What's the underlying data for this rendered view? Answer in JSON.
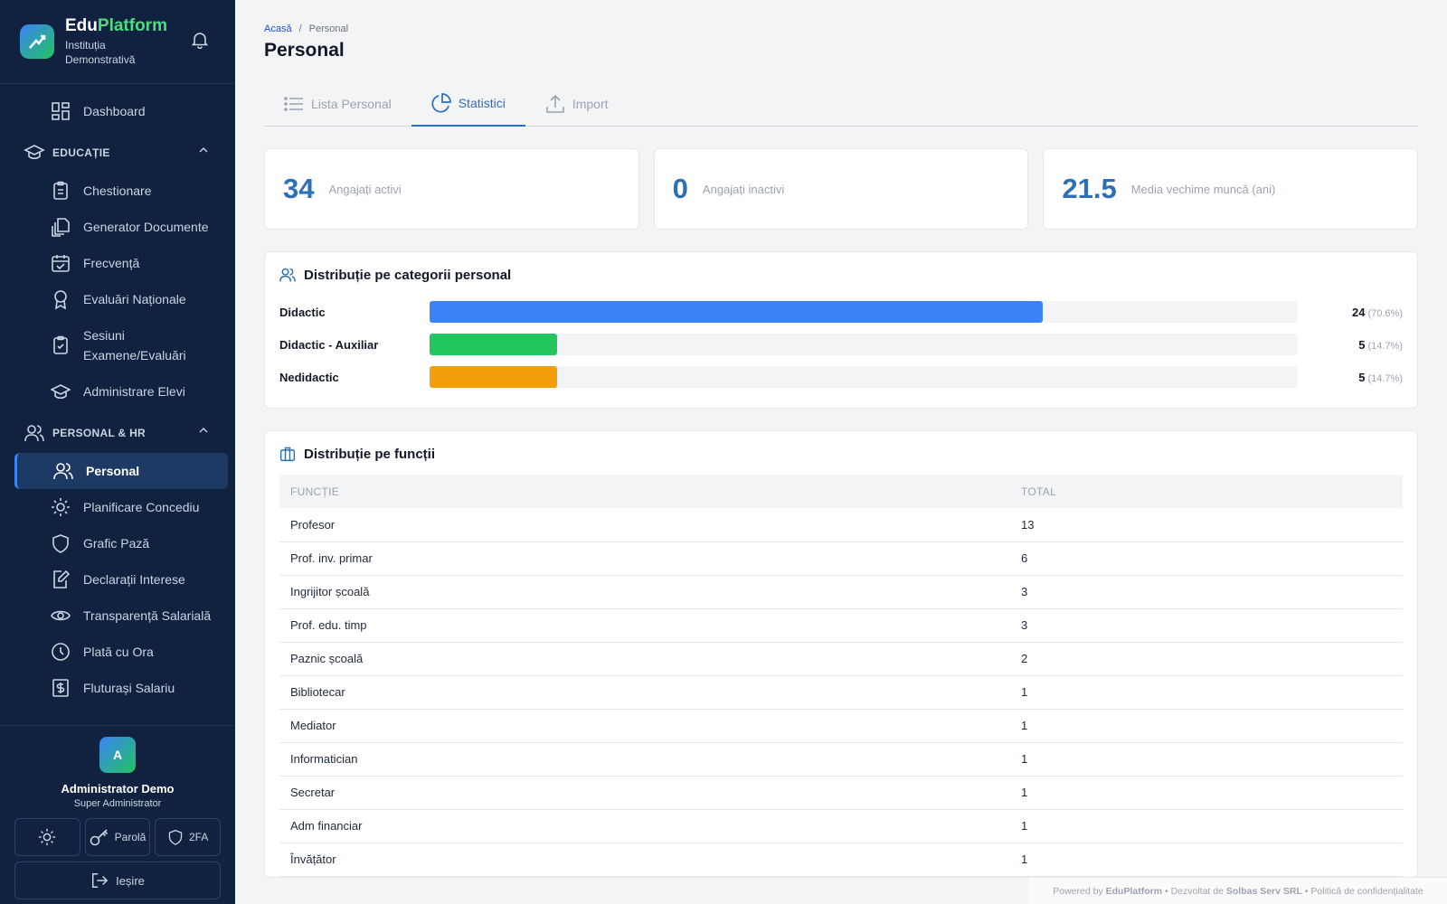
{
  "brand": {
    "name_part1": "Edu",
    "name_part2": "Platform",
    "institution": "Instituția Demonstrativă"
  },
  "sidebar": {
    "dashboard": "Dashboard",
    "section_education": "EDUCAȚIE",
    "education_items": [
      {
        "label": "Chestionare",
        "icon": "clipboard-icon"
      },
      {
        "label": "Generator Documente",
        "icon": "documents-icon"
      },
      {
        "label": "Frecvență",
        "icon": "calendar-icon"
      },
      {
        "label": "Evaluări Naționale",
        "icon": "award-icon"
      },
      {
        "label": "Sesiuni Examene/Evaluări",
        "icon": "clipboard-check-icon"
      },
      {
        "label": "Administrare Elevi",
        "icon": "graduation-cap-icon"
      }
    ],
    "section_hr": "PERSONAL & HR",
    "hr_items": [
      {
        "label": "Personal",
        "icon": "users-icon",
        "active": true
      },
      {
        "label": "Planificare Concediu",
        "icon": "sun-icon"
      },
      {
        "label": "Grafic Pază",
        "icon": "shield-icon"
      },
      {
        "label": "Declarații Interese",
        "icon": "edit-document-icon"
      },
      {
        "label": "Transparență Salarială",
        "icon": "eye-icon"
      },
      {
        "label": "Plată cu Ora",
        "icon": "clock-icon"
      },
      {
        "label": "Fluturași Salariu",
        "icon": "dollar-doc-icon"
      }
    ]
  },
  "user": {
    "initial": "A",
    "name": "Administrator Demo",
    "role": "Super Administrator",
    "password_label": "Parolă",
    "twofa_label": "2FA",
    "logout_label": "Ieșire"
  },
  "breadcrumb": {
    "home": "Acasă",
    "separator": "/",
    "current": "Personal"
  },
  "page_title": "Personal",
  "tabs": [
    {
      "label": "Lista Personal",
      "icon": "list-icon"
    },
    {
      "label": "Statistici",
      "icon": "pie-chart-icon",
      "active": true
    },
    {
      "label": "Import",
      "icon": "upload-icon"
    }
  ],
  "stats": [
    {
      "value": "34",
      "label": "Angajați activi"
    },
    {
      "value": "0",
      "label": "Angajați inactivi"
    },
    {
      "value": "21.5",
      "label": "Media vechime muncă (ani)"
    }
  ],
  "categories_card": {
    "title": "Distribuție pe categorii personal",
    "rows": [
      {
        "label": "Didactic",
        "count": "24",
        "pct": "(70.6%)",
        "fraction": 0.706,
        "color": "#3b82f6"
      },
      {
        "label": "Didactic - Auxiliar",
        "count": "5",
        "pct": "(14.7%)",
        "fraction": 0.147,
        "color": "#22c55e"
      },
      {
        "label": "Nedidactic",
        "count": "5",
        "pct": "(14.7%)",
        "fraction": 0.147,
        "color": "#f59e0b"
      }
    ]
  },
  "functions_card": {
    "title": "Distribuție pe funcții",
    "col_function": "FUNCȚIE",
    "col_total": "TOTAL",
    "rows": [
      {
        "function": "Profesor",
        "total": "13"
      },
      {
        "function": "Prof. inv. primar",
        "total": "6"
      },
      {
        "function": "Ingrijitor școală",
        "total": "3"
      },
      {
        "function": "Prof. edu. timp",
        "total": "3"
      },
      {
        "function": "Paznic școală",
        "total": "2"
      },
      {
        "function": "Bibliotecar",
        "total": "1"
      },
      {
        "function": "Mediator",
        "total": "1"
      },
      {
        "function": "Informatician",
        "total": "1"
      },
      {
        "function": "Secretar",
        "total": "1"
      },
      {
        "function": "Adm financiar",
        "total": "1"
      },
      {
        "function": "Învățător",
        "total": "1"
      }
    ]
  },
  "footer": {
    "powered": "Powered by",
    "brand": "EduPlatform",
    "sep1": "•",
    "developed": "Dezvoltat de",
    "company": "Solbas Serv SRL",
    "sep2": "•",
    "privacy": "Politică de confidențialitate"
  }
}
